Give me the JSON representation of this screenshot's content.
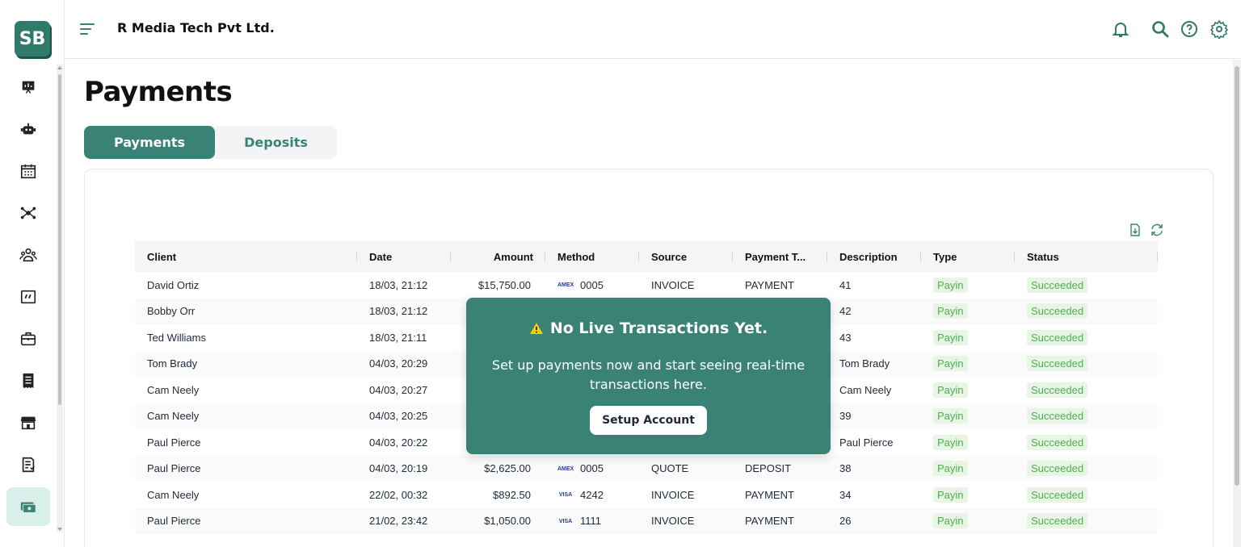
{
  "app": {
    "logo_text": "SB",
    "company_name": "R Media Tech Pvt Ltd."
  },
  "sidebar": {
    "items": [
      {
        "name": "dashboard-icon"
      },
      {
        "name": "robot-icon"
      },
      {
        "name": "calendar-icon"
      },
      {
        "name": "network-icon"
      },
      {
        "name": "clients-icon"
      },
      {
        "name": "quote-icon"
      },
      {
        "name": "briefcase-icon"
      },
      {
        "name": "receipt-icon"
      },
      {
        "name": "store-icon"
      },
      {
        "name": "report-icon"
      },
      {
        "name": "payments-icon",
        "active": true
      }
    ]
  },
  "header": {
    "icons": [
      "bell-icon",
      "search-icon",
      "help-icon",
      "settings-icon"
    ]
  },
  "page": {
    "title": "Payments",
    "tabs": [
      {
        "label": "Payments",
        "active": true
      },
      {
        "label": "Deposits",
        "active": false
      }
    ]
  },
  "table": {
    "columns": [
      "Client",
      "Date",
      "Amount",
      "Method",
      "Source",
      "Payment T...",
      "Description",
      "Type",
      "Status"
    ],
    "rows": [
      {
        "client": "David Ortiz",
        "date": "18/03, 21:12",
        "amount": "$15,750.00",
        "method_brand": "AMEX",
        "method_last4": "0005",
        "source": "INVOICE",
        "payment_type": "PAYMENT",
        "description": "41",
        "type": "Payin",
        "status": "Succeeded"
      },
      {
        "client": "Bobby Orr",
        "date": "18/03, 21:12",
        "amount": "",
        "method_brand": "",
        "method_last4": "",
        "source": "",
        "payment_type": "",
        "description": "42",
        "type": "Payin",
        "status": "Succeeded"
      },
      {
        "client": "Ted Williams",
        "date": "18/03, 21:11",
        "amount": "",
        "method_brand": "",
        "method_last4": "",
        "source": "",
        "payment_type": "",
        "description": "43",
        "type": "Payin",
        "status": "Succeeded"
      },
      {
        "client": "Tom Brady",
        "date": "04/03, 20:29",
        "amount": "",
        "method_brand": "",
        "method_last4": "",
        "source": "",
        "payment_type": "",
        "description": "Tom Brady",
        "type": "Payin",
        "status": "Succeeded"
      },
      {
        "client": "Cam Neely",
        "date": "04/03, 20:27",
        "amount": "",
        "method_brand": "",
        "method_last4": "",
        "source": "",
        "payment_type": "",
        "description": "Cam Neely",
        "type": "Payin",
        "status": "Succeeded"
      },
      {
        "client": "Cam Neely",
        "date": "04/03, 20:25",
        "amount": "",
        "method_brand": "",
        "method_last4": "",
        "source": "",
        "payment_type": "",
        "description": "39",
        "type": "Payin",
        "status": "Succeeded"
      },
      {
        "client": "Paul Pierce",
        "date": "04/03, 20:22",
        "amount": "",
        "method_brand": "",
        "method_last4": "",
        "source": "",
        "payment_type": "",
        "description": "Paul Pierce",
        "type": "Payin",
        "status": "Succeeded"
      },
      {
        "client": "Paul Pierce",
        "date": "04/03, 20:19",
        "amount": "$2,625.00",
        "method_brand": "AMEX",
        "method_last4": "0005",
        "source": "QUOTE",
        "payment_type": "DEPOSIT",
        "description": "38",
        "type": "Payin",
        "status": "Succeeded"
      },
      {
        "client": "Cam Neely",
        "date": "22/02, 00:32",
        "amount": "$892.50",
        "method_brand": "VISA",
        "method_last4": "4242",
        "source": "INVOICE",
        "payment_type": "PAYMENT",
        "description": "34",
        "type": "Payin",
        "status": "Succeeded"
      },
      {
        "client": "Paul Pierce",
        "date": "21/02, 23:42",
        "amount": "$1,050.00",
        "method_brand": "VISA",
        "method_last4": "1111",
        "source": "INVOICE",
        "payment_type": "PAYMENT",
        "description": "26",
        "type": "Payin",
        "status": "Succeeded"
      }
    ]
  },
  "overlay": {
    "title": "No Live Transactions Yet.",
    "message": "Set up payments now and start seeing real-time transactions here.",
    "button": "Setup Account"
  },
  "colors": {
    "accent": "#3a8275",
    "success_bg": "#e8f5e5",
    "success_text": "#4caf50"
  }
}
